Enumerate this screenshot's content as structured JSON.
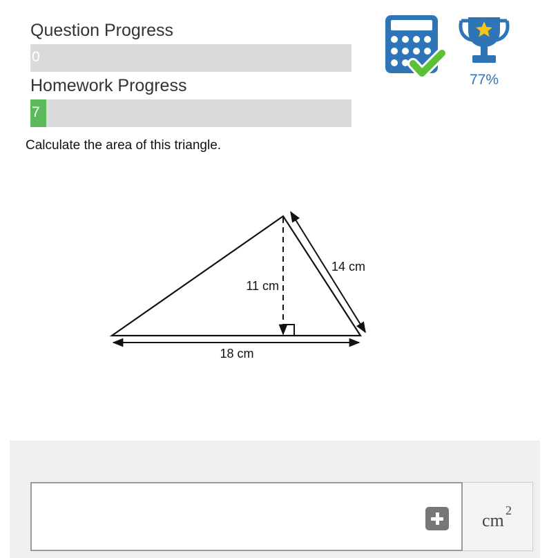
{
  "question_progress": {
    "label": "Question Progress",
    "value": "0",
    "fraction": 0
  },
  "homework_progress": {
    "label": "Homework Progress",
    "value": "7",
    "fraction": 0.05
  },
  "calculator": {
    "icon": "calculator-check-icon",
    "status": "allowed"
  },
  "trophy": {
    "icon": "trophy-star-icon",
    "score": "77%"
  },
  "question": {
    "text": "Calculate the area of this triangle."
  },
  "diagram": {
    "height_label": "11 cm",
    "side_label": "14 cm",
    "base_label": "18 cm"
  },
  "answer": {
    "value": "",
    "placeholder": "",
    "unit": "cm",
    "unit_exponent": "2"
  },
  "colors": {
    "progress_fill": "#5cb85c",
    "progress_track": "#dadada",
    "icon_blue": "#2f74b5",
    "check_green": "#5bc236",
    "trophy_star": "#f5c518"
  }
}
